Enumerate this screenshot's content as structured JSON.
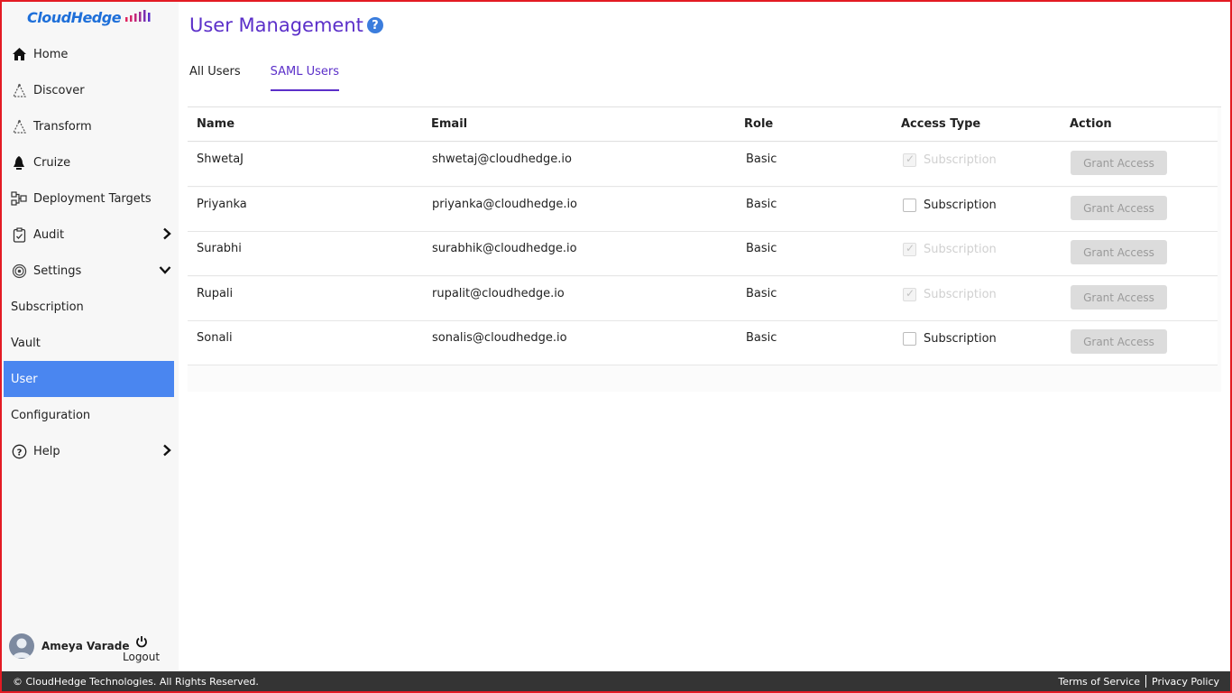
{
  "brand": {
    "name": "CloudHedge"
  },
  "sidebar": {
    "items": [
      {
        "label": "Home",
        "icon": "home-icon"
      },
      {
        "label": "Discover",
        "icon": "discover-icon"
      },
      {
        "label": "Transform",
        "icon": "transform-icon"
      },
      {
        "label": "Cruize",
        "icon": "cruize-icon"
      },
      {
        "label": "Deployment Targets",
        "icon": "deployment-targets-icon"
      },
      {
        "label": "Audit",
        "icon": "audit-icon",
        "expand": "chevron-right-icon"
      },
      {
        "label": "Settings",
        "icon": "settings-icon",
        "expand": "chevron-down-icon"
      },
      {
        "label": "Subscription"
      },
      {
        "label": "Vault"
      },
      {
        "label": "User",
        "active": true
      },
      {
        "label": "Configuration"
      },
      {
        "label": "Help",
        "icon": "help-icon",
        "expand": "chevron-right-icon"
      }
    ]
  },
  "user": {
    "name": "Ameya Varade",
    "logout_label": "Logout"
  },
  "page": {
    "title": "User Management",
    "help_glyph": "?",
    "tabs": [
      {
        "label": "All Users",
        "active": false
      },
      {
        "label": "SAML Users",
        "active": true
      }
    ]
  },
  "table": {
    "headers": [
      "Name",
      "Email",
      "Role",
      "Access Type",
      "Action"
    ],
    "rows": [
      {
        "name": "ShwetaJ",
        "email": "shwetaj@cloudhedge.io",
        "role": "Basic",
        "access": "Subscription",
        "checked": true,
        "action": "Grant Access"
      },
      {
        "name": "Priyanka",
        "email": "priyanka@cloudhedge.io",
        "role": "Basic",
        "access": "Subscription",
        "checked": false,
        "action": "Grant Access"
      },
      {
        "name": "Surabhi",
        "email": "surabhik@cloudhedge.io",
        "role": "Basic",
        "access": "Subscription",
        "checked": true,
        "action": "Grant Access"
      },
      {
        "name": "Rupali",
        "email": "rupalit@cloudhedge.io",
        "role": "Basic",
        "access": "Subscription",
        "checked": true,
        "action": "Grant Access"
      },
      {
        "name": "Sonali",
        "email": "sonalis@cloudhedge.io",
        "role": "Basic",
        "access": "Subscription",
        "checked": false,
        "action": "Grant Access"
      }
    ]
  },
  "footer": {
    "copyright": "© CloudHedge Technologies. All Rights Reserved.",
    "terms": "Terms of Service",
    "privacy": "Privacy Policy"
  },
  "colors": {
    "accent": "#5b2fc9",
    "active_nav": "#4a86f0",
    "footer_bg": "#343434",
    "brand_blue": "#1e6fd9"
  }
}
